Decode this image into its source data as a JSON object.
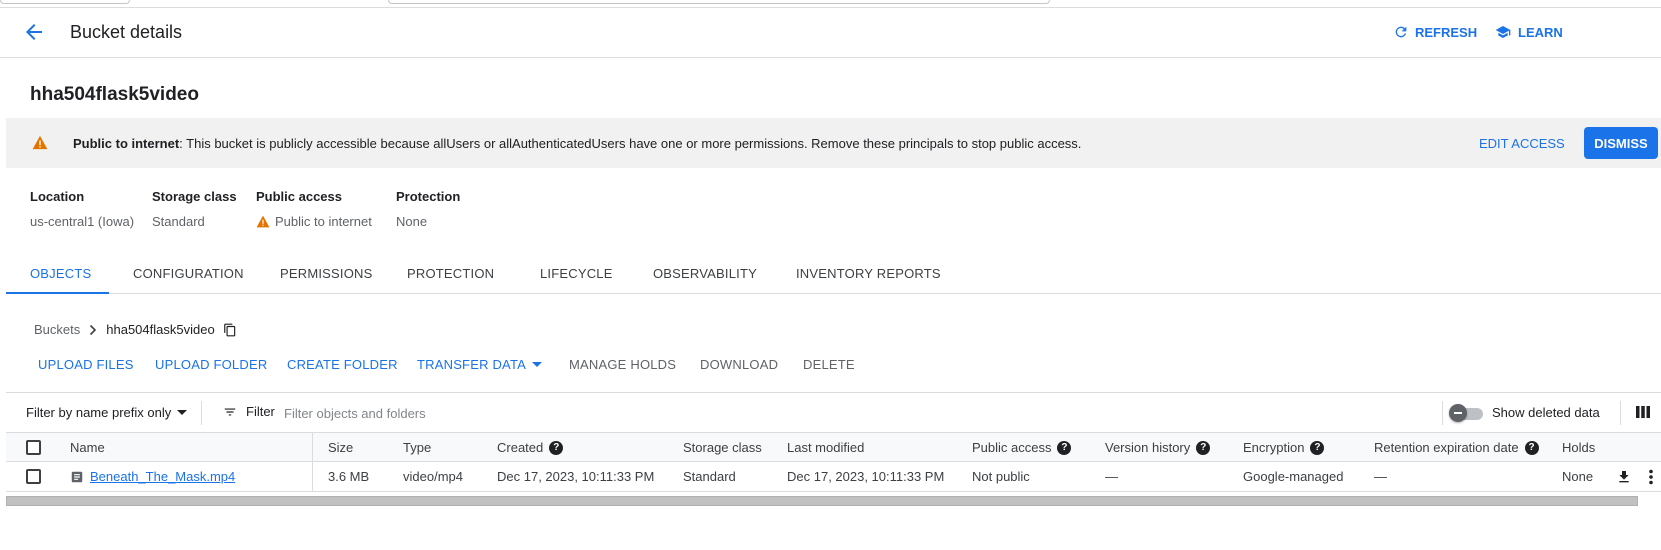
{
  "header": {
    "title": "Bucket details",
    "refresh_label": "REFRESH",
    "learn_label": "LEARN"
  },
  "bucket": {
    "name": "hha504flask5video"
  },
  "banner": {
    "bold_text": "Public to internet",
    "text": ": This bucket is publicly accessible because allUsers or allAuthenticatedUsers have one or more permissions. Remove these principals to stop public access.",
    "edit_access_label": "EDIT ACCESS",
    "dismiss_label": "DISMISS"
  },
  "properties": [
    {
      "label": "Location",
      "value": "us-central1 (Iowa)"
    },
    {
      "label": "Storage class",
      "value": "Standard"
    },
    {
      "label": "Public access",
      "value": "Public to internet"
    },
    {
      "label": "Protection",
      "value": "None"
    }
  ],
  "tabs": [
    {
      "label": "OBJECTS",
      "active": true
    },
    {
      "label": "CONFIGURATION"
    },
    {
      "label": "PERMISSIONS"
    },
    {
      "label": "PROTECTION"
    },
    {
      "label": "LIFECYCLE"
    },
    {
      "label": "OBSERVABILITY"
    },
    {
      "label": "INVENTORY REPORTS"
    }
  ],
  "breadcrumb": {
    "root": "Buckets",
    "current": "hha504flask5video"
  },
  "toolbar": {
    "upload_files": "UPLOAD FILES",
    "upload_folder": "UPLOAD FOLDER",
    "create_folder": "CREATE FOLDER",
    "transfer_data": "TRANSFER DATA",
    "manage_holds": "MANAGE HOLDS",
    "download": "DOWNLOAD",
    "delete": "DELETE"
  },
  "filter": {
    "prefix_label": "Filter by name prefix only",
    "filter_label": "Filter",
    "placeholder": "Filter objects and folders",
    "show_deleted_label": "Show deleted data"
  },
  "table": {
    "headers": [
      "Name",
      "Size",
      "Type",
      "Created",
      "Storage class",
      "Last modified",
      "Public access",
      "Version history",
      "Encryption",
      "Retention expiration date",
      "Holds"
    ],
    "rows": [
      {
        "name": "Beneath_The_Mask.mp4",
        "size": "3.6 MB",
        "type": "video/mp4",
        "created": "Dec 17, 2023, 10:11:33 PM",
        "storage_class": "Standard",
        "last_modified": "Dec 17, 2023, 10:11:33 PM",
        "public_access": "Not public",
        "version_history": "—",
        "encryption": "Google-managed",
        "retention": "—",
        "holds": "None"
      }
    ]
  },
  "colors": {
    "accent": "#1a73e8",
    "warning": "#e37400",
    "banner_bg": "#f1f1f1"
  }
}
